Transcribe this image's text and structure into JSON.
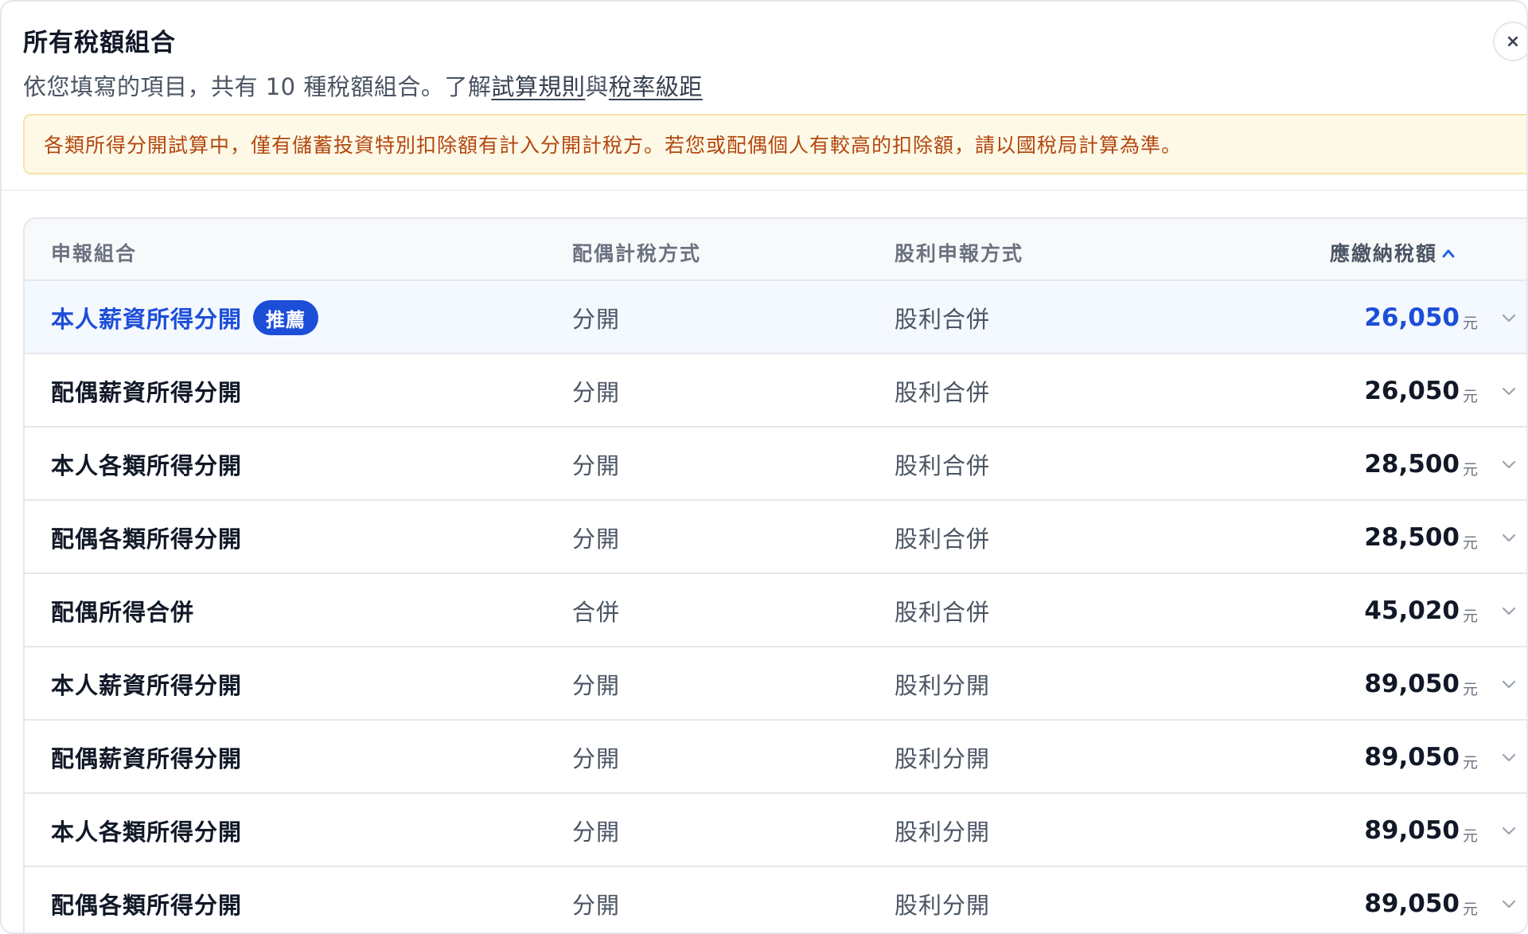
{
  "header": {
    "title": "所有稅額組合",
    "subtitle_prefix": "依您填寫的項目，共有 10 種稅額組合。了解",
    "link_rules": "試算規則",
    "subtitle_and": "與",
    "link_brackets": "稅率級距",
    "close_label": "×"
  },
  "notice": {
    "text": "各類所得分開試算中，僅有儲蓄投資特別扣除額有計入分開計稅方。若您或配偶個人有較高的扣除額，請以國稅局計算為準。"
  },
  "table": {
    "columns": {
      "combo": "申報組合",
      "spouse": "配偶計稅方式",
      "dividend": "股利申報方式",
      "tax": "應繳納稅額"
    },
    "sort_icon": "chevron-up-icon",
    "currency_unit": "元",
    "recommend_badge": "推薦",
    "rows": [
      {
        "combo": "本人薪資所得分開",
        "spouse": "分開",
        "dividend": "股利合併",
        "tax": "26,050"
      },
      {
        "combo": "配偶薪資所得分開",
        "spouse": "分開",
        "dividend": "股利合併",
        "tax": "26,050"
      },
      {
        "combo": "本人各類所得分開",
        "spouse": "分開",
        "dividend": "股利合併",
        "tax": "28,500"
      },
      {
        "combo": "配偶各類所得分開",
        "spouse": "分開",
        "dividend": "股利合併",
        "tax": "28,500"
      },
      {
        "combo": "配偶所得合併",
        "spouse": "合併",
        "dividend": "股利合併",
        "tax": "45,020"
      },
      {
        "combo": "本人薪資所得分開",
        "spouse": "分開",
        "dividend": "股利分開",
        "tax": "89,050"
      },
      {
        "combo": "配偶薪資所得分開",
        "spouse": "分開",
        "dividend": "股利分開",
        "tax": "89,050"
      },
      {
        "combo": "本人各類所得分開",
        "spouse": "分開",
        "dividend": "股利分開",
        "tax": "89,050"
      },
      {
        "combo": "配偶各類所得分開",
        "spouse": "分開",
        "dividend": "股利分開",
        "tax": "89,050"
      }
    ]
  },
  "colors": {
    "accent": "#1d4ed8",
    "notice_bg": "#fef9e7",
    "notice_text": "#b3470f"
  }
}
